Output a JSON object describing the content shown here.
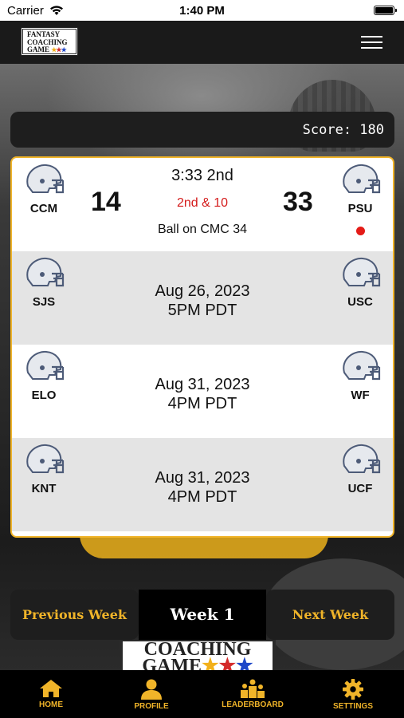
{
  "status_bar": {
    "carrier": "Carrier",
    "time": "1:40 PM"
  },
  "header": {
    "logo_lines": [
      "FANTASY",
      "COACHING",
      "GAME"
    ],
    "menu_icon": "hamburger-menu-icon"
  },
  "background": {
    "logo_lines": [
      "COACHING",
      "GAME"
    ]
  },
  "score": {
    "label": "Score: 180"
  },
  "games": [
    {
      "home": "CCM",
      "away": "PSU",
      "home_score": "14",
      "away_score": "33",
      "clock": "3:33  2nd",
      "down": "2nd & 10",
      "ball_on": "Ball on CMC 34",
      "possession": "away"
    },
    {
      "home": "SJS",
      "away": "USC",
      "date": "Aug 26, 2023",
      "time": "5PM PDT"
    },
    {
      "home": "ELO",
      "away": "WF",
      "date": "Aug 31, 2023",
      "time": "4PM PDT"
    },
    {
      "home": "KNT",
      "away": "UCF",
      "date": "Aug 31, 2023",
      "time": "4PM PDT"
    }
  ],
  "week_nav": {
    "prev": "Previous Week",
    "current": "Week 1",
    "next": "Next Week"
  },
  "tabs": [
    {
      "label": "HOME",
      "icon": "home-icon"
    },
    {
      "label": "PROFILE",
      "icon": "person-icon"
    },
    {
      "label": "LEADERBOARD",
      "icon": "leaderboard-icon"
    },
    {
      "label": "SETTINGS",
      "icon": "gear-icon"
    }
  ],
  "colors": {
    "accent": "#f0b429",
    "live_down": "#d41b1b",
    "possession": "#e41b17"
  }
}
